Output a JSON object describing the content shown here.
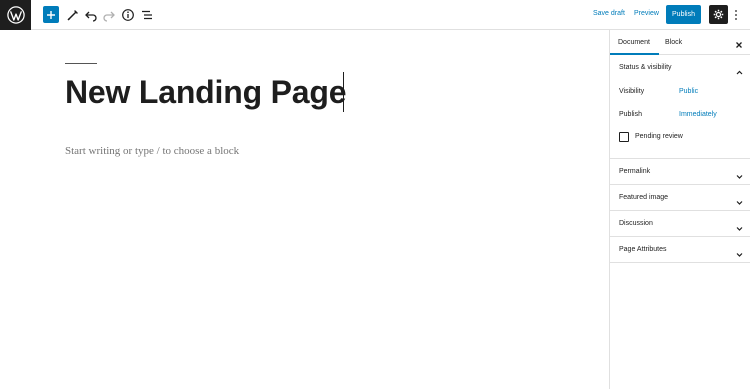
{
  "toolbar": {
    "logo_icon": "wordpress-logo-icon",
    "add_block_icon": "plus-icon",
    "tools_icon": "pencil-icon",
    "undo_icon": "undo-icon",
    "redo_icon": "redo-icon",
    "info_icon": "info-icon",
    "outline_icon": "list-view-icon",
    "save_draft_label": "Save draft",
    "preview_label": "Preview",
    "publish_label": "Publish",
    "settings_icon": "gear-icon",
    "more_icon": "more-vertical-icon"
  },
  "editor": {
    "title": "New Landing Page",
    "block_placeholder": "Start writing or type / to choose a block"
  },
  "sidebar": {
    "tabs": [
      {
        "label": "Document",
        "active": true
      },
      {
        "label": "Block",
        "active": false
      }
    ],
    "close_icon": "close-icon",
    "status_visibility": {
      "title": "Status & visibility",
      "expanded": true,
      "visibility_label": "Visibility",
      "visibility_value": "Public",
      "publish_label": "Publish",
      "publish_value": "Immediately",
      "pending_review_label": "Pending review",
      "pending_review_checked": false
    },
    "panels": [
      {
        "title": "Permalink"
      },
      {
        "title": "Featured image"
      },
      {
        "title": "Discussion"
      },
      {
        "title": "Page Attributes"
      }
    ]
  },
  "colors": {
    "accent": "#007cba",
    "dark": "#1e1e1e",
    "border": "#e0e0e0",
    "placeholder": "#757575"
  }
}
